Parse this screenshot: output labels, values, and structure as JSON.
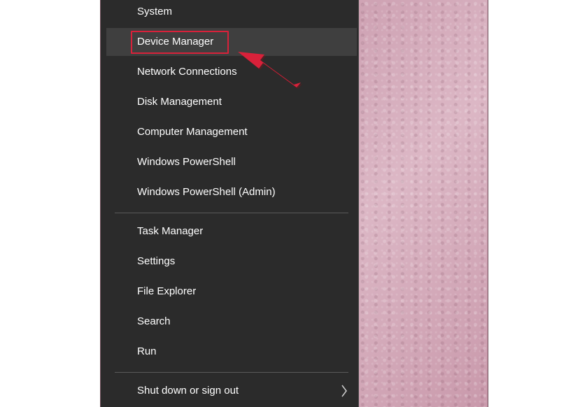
{
  "menu": {
    "items": [
      {
        "label": "System"
      },
      {
        "label": "Device Manager"
      },
      {
        "label": "Network Connections"
      },
      {
        "label": "Disk Management"
      },
      {
        "label": "Computer Management"
      },
      {
        "label": "Windows PowerShell"
      },
      {
        "label": "Windows PowerShell (Admin)"
      },
      {
        "label": "Task Manager"
      },
      {
        "label": "Settings"
      },
      {
        "label": "File Explorer"
      },
      {
        "label": "Search"
      },
      {
        "label": "Run"
      },
      {
        "label": "Shut down or sign out"
      }
    ],
    "highlighted_item": "Device Manager"
  },
  "annotation": {
    "highlight_color": "#d8213a",
    "arrow_icon": "red-arrow-icon"
  },
  "colors": {
    "menu_background": "#2b2b2b",
    "hover_background": "#3f3f3f",
    "wallpaper": "#d4a9ba"
  }
}
